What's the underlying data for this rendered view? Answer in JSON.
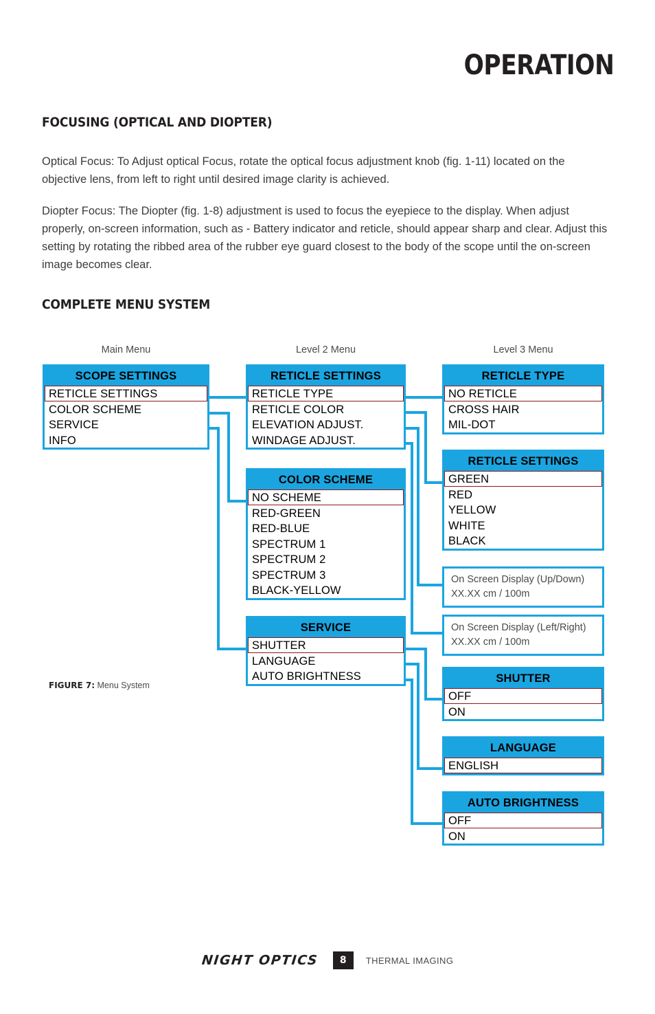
{
  "page": {
    "title": "OPERATION",
    "sections": [
      {
        "heading": "FOCUSING (OPTICAL AND DIOPTER)",
        "paragraphs": [
          "Optical Focus: To Adjust optical Focus, rotate the optical focus adjustment knob (fig. 1-11) located on the objective lens, from left to right until desired image clarity is achieved.",
          "Diopter Focus: The Diopter (fig. 1-8) adjustment is used to focus the eyepiece to the display. When adjust properly, on-screen information, such as - Battery indicator and reticle, should appear sharp and clear. Adjust this setting by rotating the ribbed area of the rubber eye guard closest to the body of the scope until the on-screen image becomes clear."
        ]
      },
      {
        "heading": "COMPLETE MENU SYSTEM"
      }
    ]
  },
  "figure": {
    "caption_label": "FIGURE 7:",
    "caption_text": " Menu System",
    "accent_color": "#1BA5E0",
    "selection_color": "#8b1a1a",
    "column_labels": [
      "Main Menu",
      "Level 2 Menu",
      "Level 3 Menu"
    ],
    "boxes": {
      "scope_settings": {
        "header": "SCOPE SETTINGS",
        "items": [
          "RETICLE SETTINGS",
          "COLOR SCHEME",
          "SERVICE",
          "INFO"
        ],
        "selected": 0
      },
      "reticle_settings_l2": {
        "header": "RETICLE SETTINGS",
        "items": [
          "RETICLE TYPE",
          "RETICLE COLOR",
          "ELEVATION ADJUST.",
          "WINDAGE ADJUST."
        ],
        "selected": 0
      },
      "color_scheme": {
        "header": "COLOR SCHEME",
        "items": [
          "NO SCHEME",
          "RED-GREEN",
          "RED-BLUE",
          "SPECTRUM 1",
          "SPECTRUM 2",
          "SPECTRUM 3",
          "BLACK-YELLOW"
        ],
        "selected": 0
      },
      "service": {
        "header": "SERVICE",
        "items": [
          "SHUTTER",
          "LANGUAGE",
          "AUTO BRIGHTNESS"
        ],
        "selected": 0
      },
      "reticle_type": {
        "header": "RETICLE TYPE",
        "items": [
          "NO RETICLE",
          "CROSS HAIR",
          "MIL-DOT"
        ],
        "selected": 0
      },
      "reticle_color": {
        "header": "RETICLE SETTINGS",
        "items": [
          "GREEN",
          "RED",
          "YELLOW",
          "WHITE",
          "BLACK"
        ],
        "selected": 0
      },
      "osd_updown": {
        "lines": [
          "On Screen Display (Up/Down)",
          "XX.XX cm / 100m"
        ]
      },
      "osd_leftright": {
        "lines": [
          "On Screen Display (Left/Right)",
          "XX.XX cm / 100m"
        ]
      },
      "shutter": {
        "header": "SHUTTER",
        "items": [
          "OFF",
          "ON"
        ],
        "selected": 0
      },
      "language": {
        "header": "LANGUAGE",
        "items": [
          "ENGLISH"
        ],
        "selected": 0
      },
      "auto_brightness": {
        "header": "AUTO BRIGHTNESS",
        "items": [
          "OFF",
          "ON"
        ],
        "selected": 0
      }
    }
  },
  "footer": {
    "brand": "NIGHT OPTICS",
    "page_number": "8",
    "note": "THERMAL IMAGING"
  }
}
